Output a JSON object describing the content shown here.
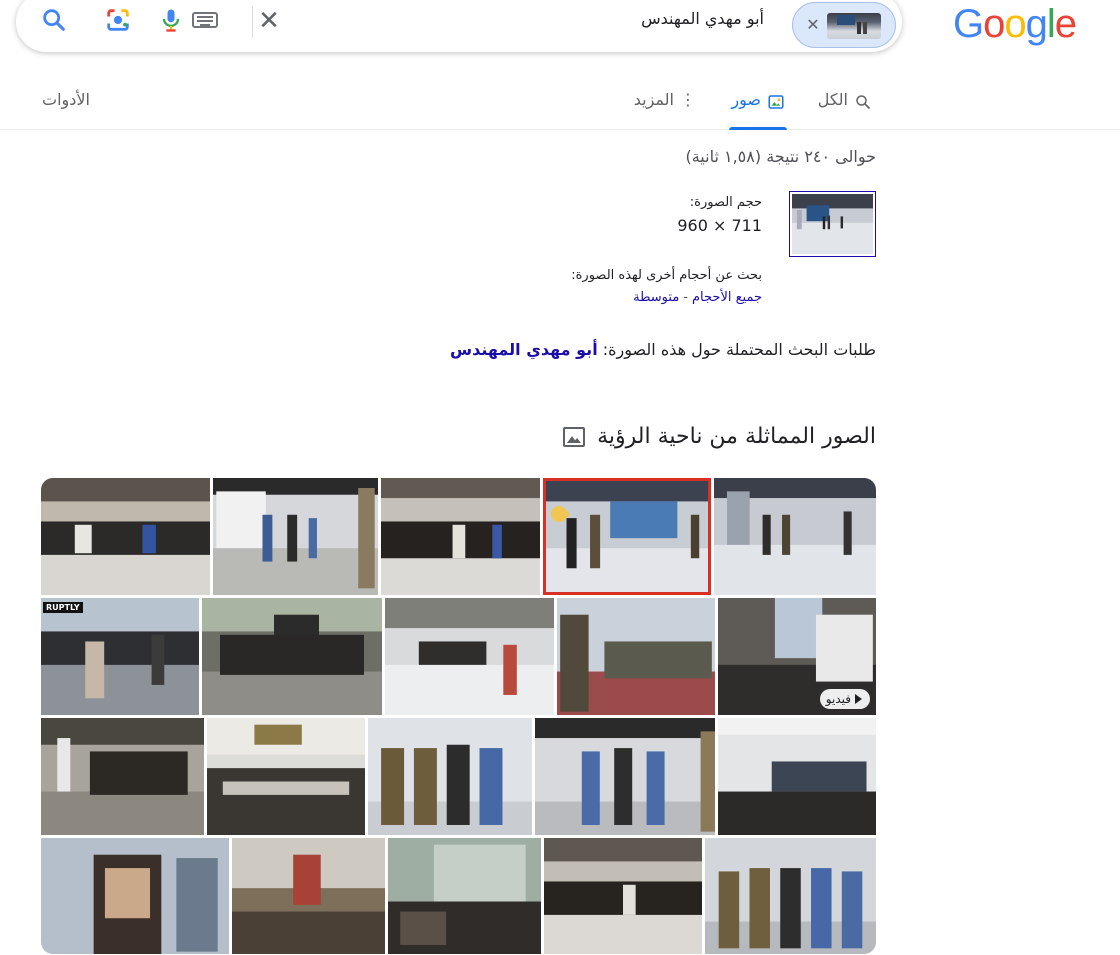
{
  "logo": {
    "letters": [
      "G",
      "o",
      "o",
      "g",
      "l",
      "e"
    ],
    "colors": [
      "#4285f4",
      "#ea4335",
      "#fbbc05",
      "#4285f4",
      "#34a853",
      "#ea4335"
    ]
  },
  "search": {
    "query": "أبو مهدي المهندس",
    "clear_glyph": "✕",
    "chip_close_glyph": "✕"
  },
  "tabs": {
    "all": "الكل",
    "images": "صور",
    "more": "المزيد",
    "tools": "الأدوات"
  },
  "results": {
    "stats": "حوالى ٢٤٠ نتيجة (١,٥٨ ثانية)",
    "size_label": "حجم الصورة:",
    "size_value": "960 × 711",
    "other_sizes_label": "بحث عن أحجام أخرى لهذه الصورة:",
    "link_all_sizes": "جميع الأحجام",
    "link_separator": "-",
    "link_medium": "متوسطة",
    "best_guess_label": "طلبات البحث المحتملة حول هذه الصورة:",
    "best_guess_link": "أبو مهدي المهندس"
  },
  "similar": {
    "heading": "الصور المماثلة من ناحية الرؤية",
    "video_badge": "فيديو",
    "watermark": "RUPTLY"
  }
}
